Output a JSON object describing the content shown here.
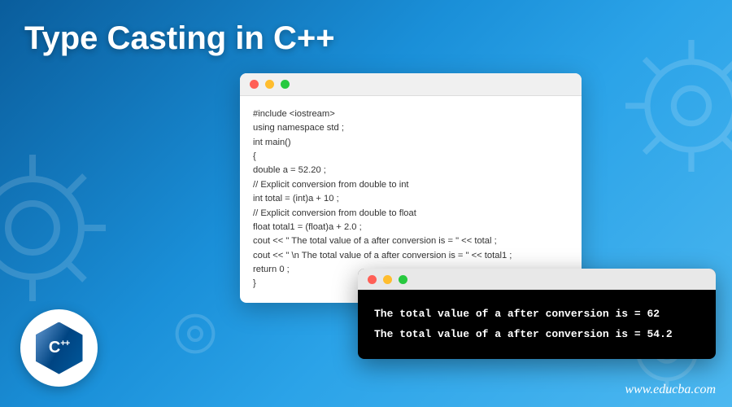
{
  "title": "Type Casting in C++",
  "code": {
    "lines": [
      "#include <iostream>",
      "using namespace std ;",
      "int main()",
      "{",
      "double a = 52.20 ;",
      "// Explicit conversion from double to int",
      "int total = (int)a + 10 ;",
      "// Explicit conversion from double to float",
      "float total1 = (float)a + 2.0 ;",
      "cout << \" The total value of a after conversion is = \" << total  ;",
      "cout << \" \\n The total value of a after conversion is = \" << total1 ;",
      "return 0 ;",
      "}"
    ]
  },
  "terminal": {
    "lines": [
      "The total value of a after conversion is = 62",
      "The total value of a after conversion is = 54.2"
    ]
  },
  "logo": {
    "text": "C",
    "suffix": "++"
  },
  "url": "www.educba.com"
}
